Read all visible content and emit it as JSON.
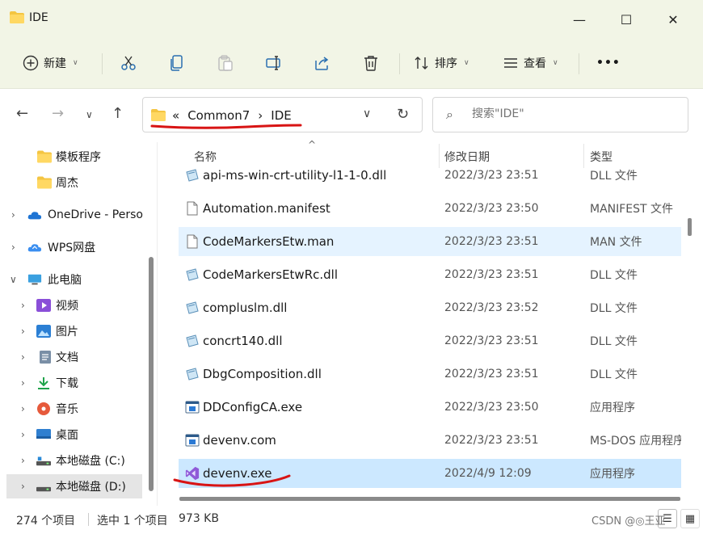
{
  "window": {
    "title": "IDE",
    "minimize_label": "—",
    "maximize_label": "☐",
    "close_label": "✕"
  },
  "toolbar": {
    "new_label": "新建",
    "sort_label": "排序",
    "view_label": "查看",
    "more_label": "•••"
  },
  "address": {
    "breadcrumb_prefix": "«",
    "crumbs": [
      "Common7",
      "IDE"
    ],
    "separator": "›"
  },
  "search": {
    "placeholder": "搜索\"IDE\""
  },
  "sidebar": {
    "items": [
      {
        "label": "模板程序",
        "icon": "folder-icon"
      },
      {
        "label": "周杰",
        "icon": "folder-icon"
      },
      {
        "label": "OneDrive - Perso",
        "icon": "onedrive-icon"
      },
      {
        "label": "WPS网盘",
        "icon": "cloud-icon"
      },
      {
        "label": "此电脑",
        "icon": "computer-icon"
      },
      {
        "label": "视频",
        "icon": "video-icon"
      },
      {
        "label": "图片",
        "icon": "picture-icon"
      },
      {
        "label": "文档",
        "icon": "document-icon"
      },
      {
        "label": "下载",
        "icon": "download-icon"
      },
      {
        "label": "音乐",
        "icon": "music-icon"
      },
      {
        "label": "桌面",
        "icon": "desktop-icon"
      },
      {
        "label": "本地磁盘 (C:)",
        "icon": "drive-icon"
      },
      {
        "label": "本地磁盘 (D:)",
        "icon": "drive-icon"
      }
    ]
  },
  "columns": {
    "name": "名称",
    "date": "修改日期",
    "type": "类型"
  },
  "files": [
    {
      "name": "api-ms-win-crt-utility-l1-1-0.dll",
      "date": "2022/3/23 23:51",
      "type": "DLL 文件",
      "icon": "dll-icon"
    },
    {
      "name": "Automation.manifest",
      "date": "2022/3/23 23:50",
      "type": "MANIFEST 文件",
      "icon": "file-icon"
    },
    {
      "name": "CodeMarkersEtw.man",
      "date": "2022/3/23 23:51",
      "type": "MAN 文件",
      "icon": "file-icon"
    },
    {
      "name": "CodeMarkersEtwRc.dll",
      "date": "2022/3/23 23:51",
      "type": "DLL 文件",
      "icon": "dll-icon"
    },
    {
      "name": "compluslm.dll",
      "date": "2022/3/23 23:52",
      "type": "DLL 文件",
      "icon": "dll-icon"
    },
    {
      "name": "concrt140.dll",
      "date": "2022/3/23 23:51",
      "type": "DLL 文件",
      "icon": "dll-icon"
    },
    {
      "name": "DbgComposition.dll",
      "date": "2022/3/23 23:51",
      "type": "DLL 文件",
      "icon": "dll-icon"
    },
    {
      "name": "DDConfigCA.exe",
      "date": "2022/3/23 23:50",
      "type": "应用程序",
      "icon": "exe-icon"
    },
    {
      "name": "devenv.com",
      "date": "2022/3/23 23:51",
      "type": "MS-DOS 应用程序",
      "icon": "exe-icon"
    },
    {
      "name": "devenv.exe",
      "date": "2022/4/9 12:09",
      "type": "应用程序",
      "icon": "visual-studio-icon"
    }
  ],
  "status": {
    "item_count": "274 个项目",
    "selected": "选中 1 个项目",
    "size": "973 KB"
  },
  "watermark": "CSDN @◎王亚"
}
